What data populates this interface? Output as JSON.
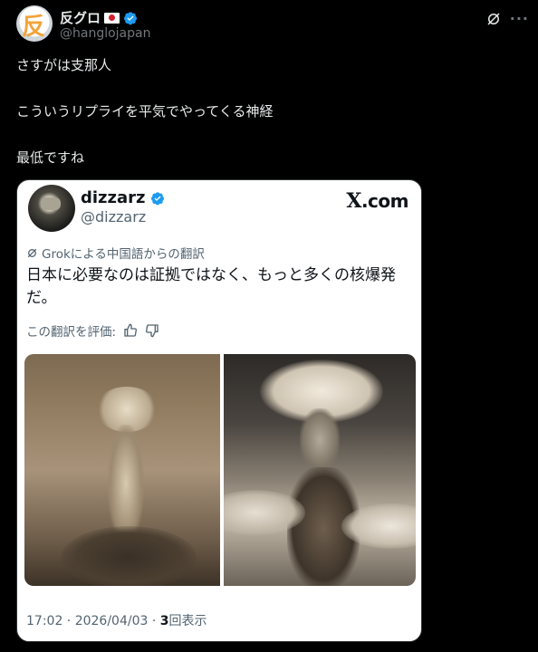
{
  "post": {
    "author": {
      "display_name": "反グロ",
      "handle": "@hanglojapan",
      "avatar_glyph": "反"
    },
    "lines": [
      "さすがは支那人",
      "こういうリプライを平気でやってくる神経",
      "最低ですね"
    ]
  },
  "quoted": {
    "author": {
      "display_name": "dizzarz",
      "handle": "@dizzarz"
    },
    "source_label": ".com",
    "source_mark": "X",
    "translation_note": "Grokによる中国語からの翻訳",
    "translation_text": "日本に必要なのは証拠ではなく、もっと多くの核爆発だ。",
    "rate_label": "この翻訳を評価:",
    "timestamp": "17:02 · 2026/04/03 · ",
    "view_count": "3",
    "view_label": "回表示"
  },
  "colors": {
    "background": "#000000",
    "text_primary": "#e7e9ea",
    "text_secondary": "#71767b",
    "verified_blue": "#1d9bf0",
    "card_background": "#ffffff"
  },
  "icons": {
    "grok": "grok-icon",
    "more": "more-icon",
    "verified": "verified-badge-icon",
    "thumbs_up": "thumbs-up-icon",
    "thumbs_down": "thumbs-down-icon"
  }
}
